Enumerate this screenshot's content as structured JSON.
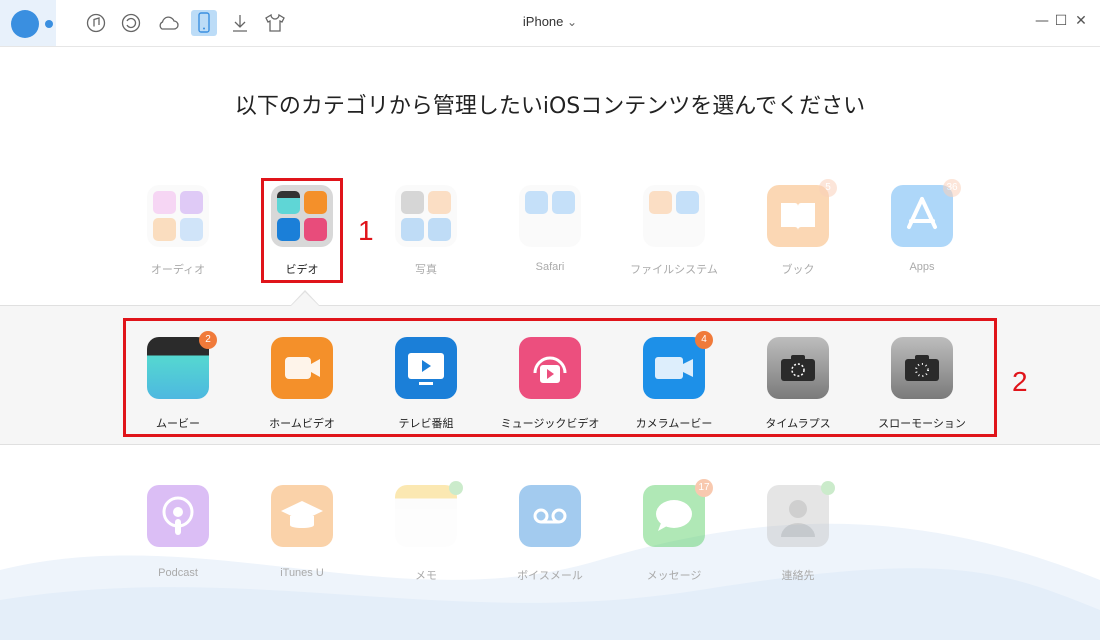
{
  "app": {
    "device_name": "iPhone",
    "device_caret": "⌄"
  },
  "toolbar": {
    "icons": [
      "music-icon",
      "restore-icon",
      "cloud-icon",
      "phone-icon",
      "download-icon",
      "shirt-icon"
    ],
    "active": "phone-icon"
  },
  "window_controls": {
    "minimize": "—",
    "maximize": "☐",
    "close": "✕"
  },
  "heading": "以下のカテゴリから管理したいiOSコンテンツを選んでください",
  "categories": [
    {
      "label": "オーディオ"
    },
    {
      "label": "ビデオ"
    },
    {
      "label": "写真"
    },
    {
      "label": "Safari"
    },
    {
      "label": "ファイルシステム"
    },
    {
      "label": "ブック",
      "badge": "5"
    },
    {
      "label": "Apps",
      "badge": "36"
    }
  ],
  "annotations": {
    "one": "1",
    "two": "2"
  },
  "video_subcategories": [
    {
      "label": "ムービー",
      "badge": "2"
    },
    {
      "label": "ホームビデオ"
    },
    {
      "label": "テレビ番組"
    },
    {
      "label": "ミュージックビデオ"
    },
    {
      "label": "カメラムービー",
      "badge": "4"
    },
    {
      "label": "タイムラプス"
    },
    {
      "label": "スローモーション"
    }
  ],
  "bottom_row": [
    {
      "label": "Podcast"
    },
    {
      "label": "iTunes U"
    },
    {
      "label": "メモ"
    },
    {
      "label": "ボイスメール"
    },
    {
      "label": "メッセージ",
      "badge": "17"
    },
    {
      "label": "連絡先"
    }
  ],
  "colors": {
    "accent": "#3a8fe0",
    "highlight": "#e0141a",
    "badge": "#f07a3a"
  }
}
